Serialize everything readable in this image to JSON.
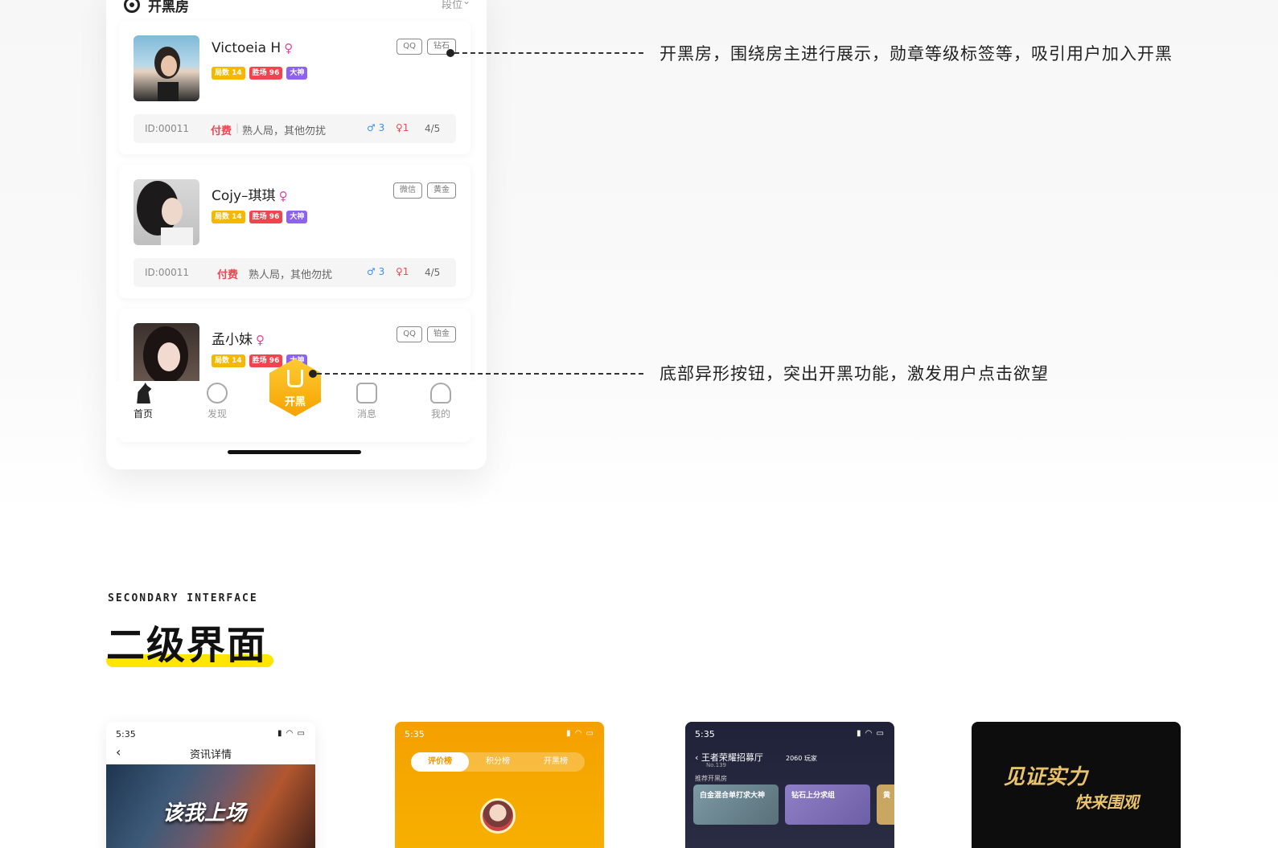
{
  "section_header": {
    "title": "开黑房",
    "rank_label": "段位"
  },
  "rooms": [
    {
      "name": "Victoeia H",
      "gender": "♀",
      "tags": [
        "局数 14",
        "胜场 96",
        "大神"
      ],
      "platforms": [
        "QQ",
        "钻石"
      ],
      "id": "ID:00011",
      "paid": "付费",
      "desc": "熟人局，其他勿扰",
      "male": "♂ 3",
      "female": "♀1",
      "count": "4/5"
    },
    {
      "name": "Cojy–琪琪",
      "gender": "♀",
      "tags": [
        "局数 14",
        "胜场 96",
        "大神"
      ],
      "platforms": [
        "微信",
        "黄金"
      ],
      "id": "ID:00011",
      "paid": "付费",
      "desc": "熟人局，其他勿扰",
      "male": "♂ 3",
      "female": "♀1",
      "count": "4/5"
    },
    {
      "name": "孟小妹",
      "gender": "♀",
      "tags": [
        "局数 14",
        "胜场 96",
        "大神"
      ],
      "platforms": [
        "QQ",
        "铂金"
      ]
    }
  ],
  "tabbar": {
    "home": "首页",
    "discover": "发现",
    "center": "开黑",
    "messages": "消息",
    "mine": "我的"
  },
  "annotations": {
    "note1": "开黑房，围绕房主进行展示，勋章等级标签等，吸引用户加入开黑",
    "note2": "底部异形按钮，突出开黑功能，激发用户点击欲望"
  },
  "section": {
    "en": "SECONDARY INTERFACE",
    "cn": "二级界面",
    "highlight_color": "#ffe600"
  },
  "thumbnails": {
    "news": {
      "time": "5:35",
      "title": "资讯详情",
      "banner_text": "该我上场"
    },
    "ranking": {
      "time": "5:35",
      "tabs": [
        "评价榜",
        "积分榜",
        "开黑榜"
      ]
    },
    "recruit": {
      "time": "5:35",
      "title": "王者荣耀招募厅",
      "subtitle": "No.139",
      "players": "2060 玩家",
      "rec_label": "推荐开黑房",
      "cards": [
        "白金混合单打求大神",
        "钻石上分求组",
        "黄"
      ]
    },
    "promo": {
      "line1": "见证实力",
      "line2": "快来围观"
    }
  },
  "colors": {
    "accent": "#f5a300",
    "female": "#e8459a",
    "male": "#3c8ff0",
    "paid": "#f0444f"
  }
}
